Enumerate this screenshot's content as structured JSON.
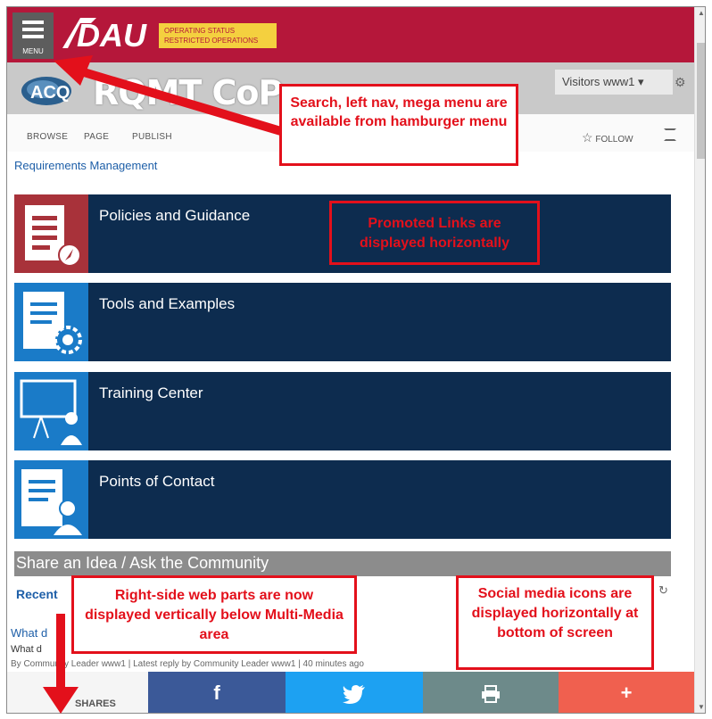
{
  "header": {
    "menu_label": "MENU",
    "logo_text": "DAU",
    "status_line1": "OPERATING STATUS",
    "status_line2": "RESTRICTED OPERATIONS"
  },
  "site": {
    "logo_text": "ACQ",
    "title": "RQMT CoP",
    "visitors_label": "Visitors www1 ▾",
    "settings_icon": "gear-icon"
  },
  "ribbon": {
    "browse": "BROWSE",
    "page": "PAGE",
    "publish": "PUBLISH",
    "follow": "FOLLOW"
  },
  "breadcrumb": "Requirements Management",
  "promoted_links": [
    {
      "label": "Policies and Guidance",
      "icon": "document-compass-icon",
      "icon_bg": "#a8323a"
    },
    {
      "label": "Tools and Examples",
      "icon": "document-gear-icon",
      "icon_bg": "#1a7bc8"
    },
    {
      "label": "Training Center",
      "icon": "presentation-icon",
      "icon_bg": "#1a7bc8"
    },
    {
      "label": "Points of Contact",
      "icon": "document-person-icon",
      "icon_bg": "#1a7bc8"
    }
  ],
  "community": {
    "header": "Share an Idea / Ask the Community",
    "recent_tab": "Recent",
    "post_title": "What d",
    "post_body": "What d",
    "post_meta": "By Community Leader www1  |  Latest reply by Community Leader www1  |  40 minutes ago"
  },
  "share": {
    "label": "SHARES",
    "buttons": [
      {
        "name": "facebook",
        "glyph": "f",
        "color": "#3b5998"
      },
      {
        "name": "twitter",
        "glyph": "🐦",
        "color": "#1da1f2"
      },
      {
        "name": "print",
        "glyph": "🖶",
        "color": "#6d8a8a"
      },
      {
        "name": "more",
        "glyph": "+",
        "color": "#f0604f"
      }
    ]
  },
  "annotations": {
    "hamburger": "Search, left nav, mega menu are available from hamburger menu",
    "promoted": "Promoted Links are displayed horizontally",
    "webparts": "Right-side web parts are now displayed vertically below Multi-Media area",
    "social": "Social media icons are displayed horizontally at bottom of screen"
  },
  "colors": {
    "brand": "#b5173a",
    "tile": "#0d2c4f",
    "annotation": "#e3101b"
  }
}
